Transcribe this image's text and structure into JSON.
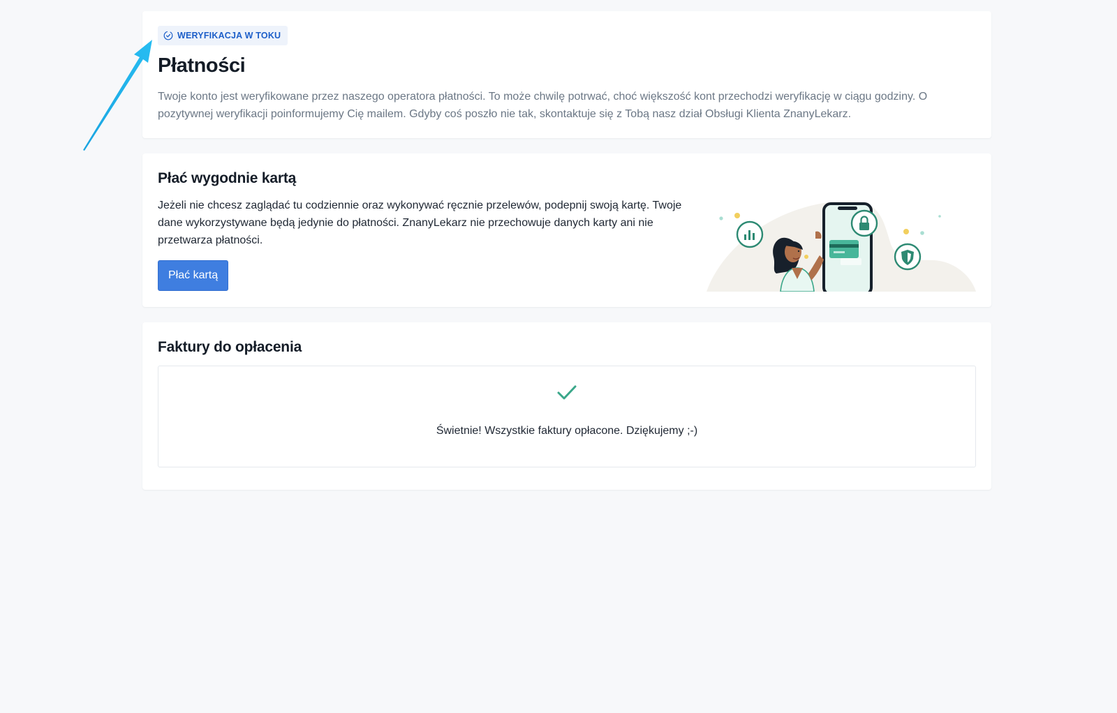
{
  "verification": {
    "badge_icon": "clock-check-icon",
    "badge": "WERYFIKACJA W TOKU",
    "title": "Płatności",
    "text": "Twoje konto jest weryfikowane przez naszego operatora płatności. To może chwilę potrwać, choć większość kont przechodzi weryfikację w ciągu godziny. O pozytywnej weryfikacji poinformujemy Cię mailem. Gdyby coś poszło nie tak, skontaktuje się z Tobą nasz dział Obsługi Klienta ZnanyLekarz."
  },
  "pay_card": {
    "title": "Płać wygodnie kartą",
    "text": "Jeżeli nie chcesz zaglądać tu codziennie oraz wykonywać ręcznie przelewów, podepnij swoją kartę. Twoje dane wykorzystywane będą jedynie do płatności. ZnanyLekarz nie przechowuje danych karty ani nie przetwarza płatności.",
    "button": "Płać kartą",
    "illustration": "woman-with-phone-card-illustration"
  },
  "invoices": {
    "title": "Faktury do opłacenia",
    "icon": "checkmark-icon",
    "message": "Świetnie! Wszystkie faktury opłacone. Dziękujemy ;-)"
  },
  "colors": {
    "background": "#f7f8fa",
    "primary_button": "#3f7ee0",
    "badge_text": "#1d5fc9",
    "badge_bg": "#eef3fb",
    "success": "#3aa78a",
    "annotation_arrow": "#1ab0ea"
  }
}
